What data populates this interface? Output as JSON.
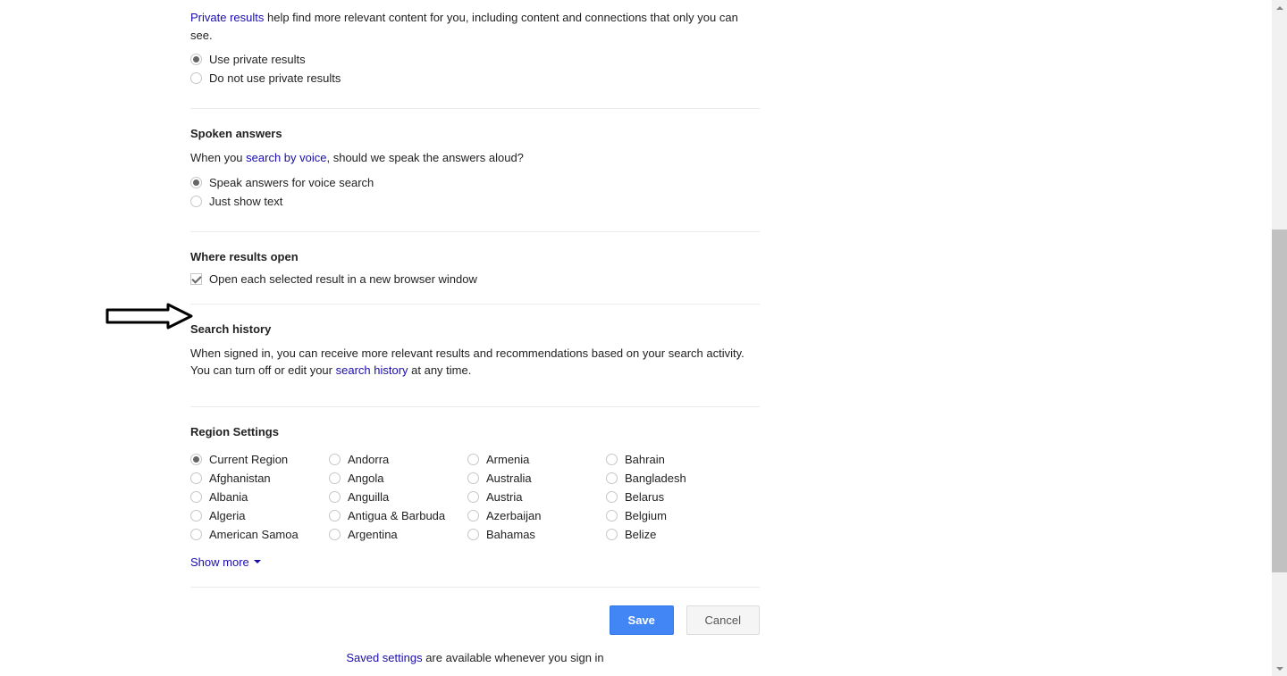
{
  "private_results": {
    "link_text": "Private results",
    "desc_after": " help find more relevant content for you, including content and connections that only you can see.",
    "options": {
      "use": "Use private results",
      "donot": "Do not use private results"
    }
  },
  "spoken": {
    "title": "Spoken answers",
    "desc_before": "When you ",
    "link_text": "search by voice",
    "desc_after": ", should we speak the answers aloud?",
    "options": {
      "speak": "Speak answers for voice search",
      "text": "Just show text"
    }
  },
  "where_open": {
    "title": "Where results open",
    "checkbox_label": "Open each selected result in a new browser window"
  },
  "history": {
    "title": "Search history",
    "desc_before": "When signed in, you can receive more relevant results and recommendations based on your search activity. You can turn off or edit your ",
    "link_text": "search history",
    "desc_after": " at any time."
  },
  "region": {
    "title": "Region Settings",
    "columns": [
      [
        "Current Region",
        "Afghanistan",
        "Albania",
        "Algeria",
        "American Samoa"
      ],
      [
        "Andorra",
        "Angola",
        "Anguilla",
        "Antigua & Barbuda",
        "Argentina"
      ],
      [
        "Armenia",
        "Australia",
        "Austria",
        "Azerbaijan",
        "Bahamas"
      ],
      [
        "Bahrain",
        "Bangladesh",
        "Belarus",
        "Belgium",
        "Belize"
      ]
    ],
    "show_more": "Show more"
  },
  "buttons": {
    "save": "Save",
    "cancel": "Cancel"
  },
  "footer": {
    "link": "Saved settings",
    "after": " are available whenever you sign in"
  }
}
